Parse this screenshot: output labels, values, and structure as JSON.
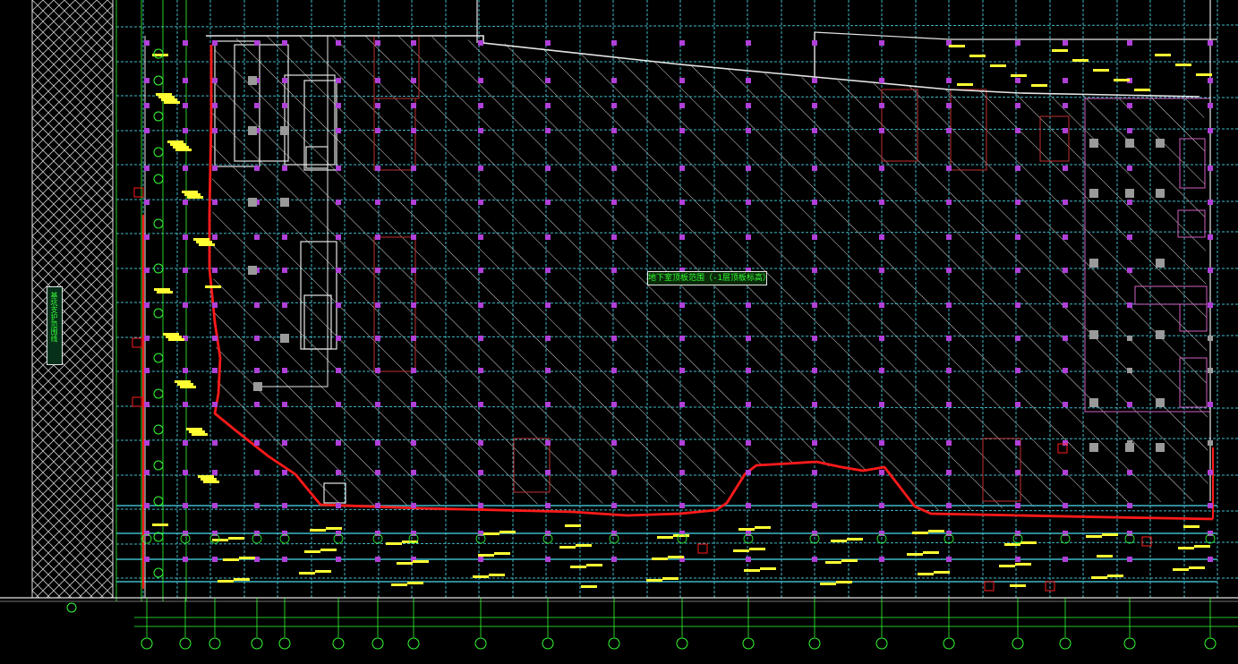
{
  "drawing": {
    "center_label": "地下室顶板范围（-1层顶板标高）",
    "side_label": "基坑支护范围线"
  },
  "colors": {
    "background": "#000000",
    "grid": "#3fb8c8",
    "axis": "#33ff33",
    "outline": "#e6e6e6",
    "boundary": "#ff1a1a",
    "column": "#b040d8",
    "hatch": "#d8d8d8",
    "beam_text": "#ffff33",
    "accent_red": "#c03030",
    "pink": "#d060c0",
    "column_grey": "#9a9a9a"
  },
  "icons": [
    "axis-bubble-icon",
    "column-marker-icon"
  ]
}
